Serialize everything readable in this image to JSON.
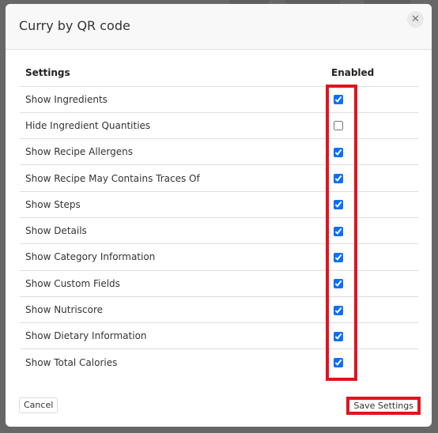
{
  "modal": {
    "title": "Curry by QR code",
    "close_icon": "close-icon"
  },
  "table": {
    "headers": [
      "Settings",
      "Enabled"
    ],
    "rows": [
      {
        "label": "Show Ingredients",
        "enabled": true
      },
      {
        "label": "Hide Ingredient Quantities",
        "enabled": false
      },
      {
        "label": "Show Recipe Allergens",
        "enabled": true
      },
      {
        "label": "Show Recipe May Contains Traces Of",
        "enabled": true
      },
      {
        "label": "Show Steps",
        "enabled": true
      },
      {
        "label": "Show Details",
        "enabled": true
      },
      {
        "label": "Show Category Information",
        "enabled": true
      },
      {
        "label": "Show Custom Fields",
        "enabled": true
      },
      {
        "label": "Show Nutriscore",
        "enabled": true
      },
      {
        "label": "Show Dietary Information",
        "enabled": true
      },
      {
        "label": "Show Total Calories",
        "enabled": true
      }
    ]
  },
  "footer": {
    "cancel_label": "Cancel",
    "save_label": "Save Settings"
  },
  "colors": {
    "accent": "#0d6efd",
    "highlight": "#e0141e",
    "overlay": "#676767"
  }
}
